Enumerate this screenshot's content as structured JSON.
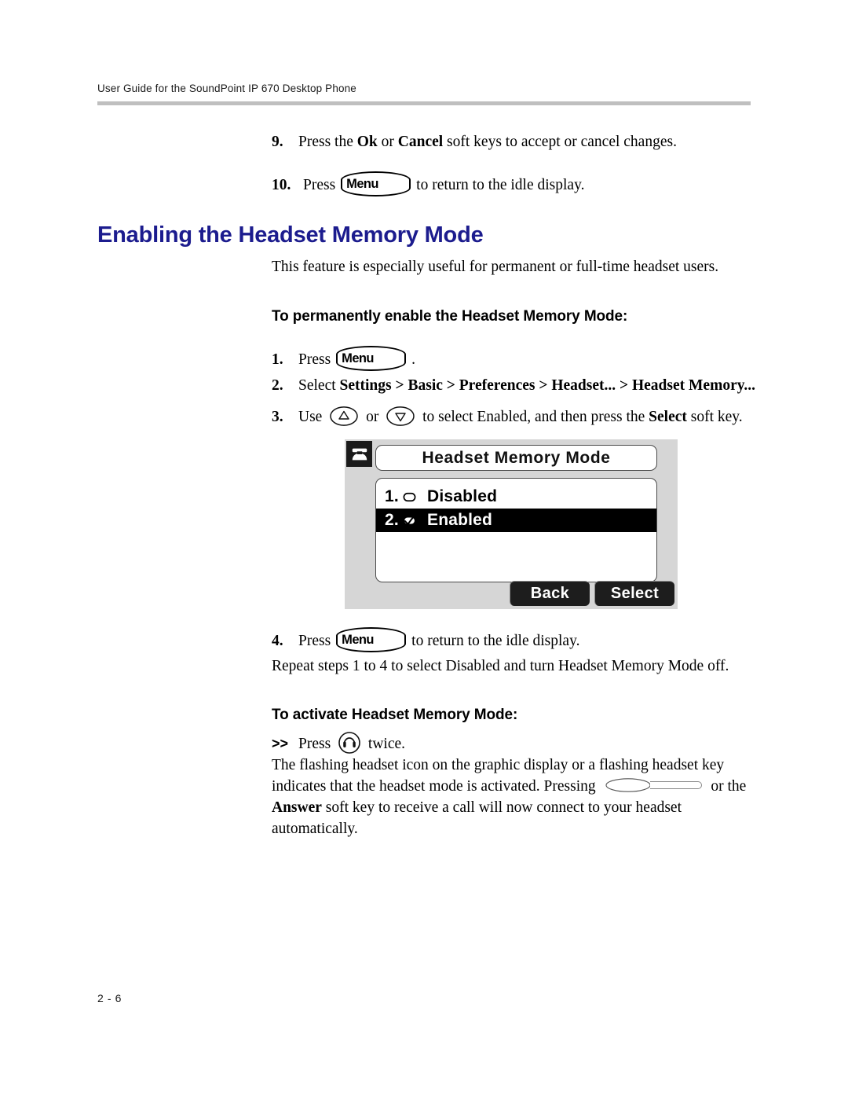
{
  "header": {
    "running_head": "User Guide for the SoundPoint IP 670 Desktop Phone"
  },
  "footer": {
    "page_number": "2 - 6"
  },
  "top_steps": [
    {
      "number": "9.",
      "text_before": "Press the ",
      "bold1": "Ok",
      "mid1": " or ",
      "bold2": "Cancel",
      "text_after": " soft keys to accept or cancel changes."
    },
    {
      "number": "10.",
      "text_before": "Press",
      "key_label": "Menu",
      "text_after": "to return to the idle display."
    }
  ],
  "section": {
    "heading": "Enabling the Headset Memory Mode",
    "intro": "This feature is especially useful for permanent or full-time headset users."
  },
  "subsection_enable": {
    "heading": "To permanently enable the Headset Memory Mode:",
    "steps": [
      {
        "number": "1.",
        "text_before": "Press",
        "key_label": "Menu",
        "text_after": "."
      },
      {
        "number": "2.",
        "lead": "Select ",
        "path": "Settings > Basic > Preferences > Headset... > Headset Memory..."
      },
      {
        "number": "3.",
        "lead": "Use",
        "mid": "to select Enabled, and then press the ",
        "bold": "Select",
        "tail": " soft key."
      },
      {
        "number": "4.",
        "text_before": "Press",
        "key_label": "Menu",
        "text_after": "to return to the idle display."
      }
    ],
    "repeat_note": "Repeat steps 1 to 4 to select Disabled and turn Headset Memory Mode off."
  },
  "subsection_activate": {
    "heading": "To activate Headset Memory Mode:",
    "bullet_marker": ">>",
    "bullet_before": "Press",
    "bullet_after": "twice.",
    "paragraph_line1": "The flashing headset icon on the graphic display or a flashing headset key",
    "paragraph_line2_before": "indicates that the headset mode is activated. Pressing",
    "paragraph_line2_after": "or the",
    "paragraph_line3_bold": "Answer",
    "paragraph_line3_after": " soft key to receive a call will now connect to your headset",
    "paragraph_line4": "automatically."
  },
  "lcd": {
    "status_icon": "phone-handset-icon",
    "title": "Headset Memory Mode",
    "items": [
      {
        "index": "1.",
        "label": "Disabled",
        "checked": false,
        "selected": false
      },
      {
        "index": "2.",
        "label": "Enabled",
        "checked": true,
        "selected": true
      }
    ],
    "softkeys": [
      {
        "label": "Back"
      },
      {
        "label": "Select"
      }
    ]
  },
  "colors": {
    "heading_blue": "#1c1c8e",
    "header_rule": "#bfbfbf",
    "lcd_background": "#d6d6d6",
    "lcd_selected": "#000000"
  }
}
